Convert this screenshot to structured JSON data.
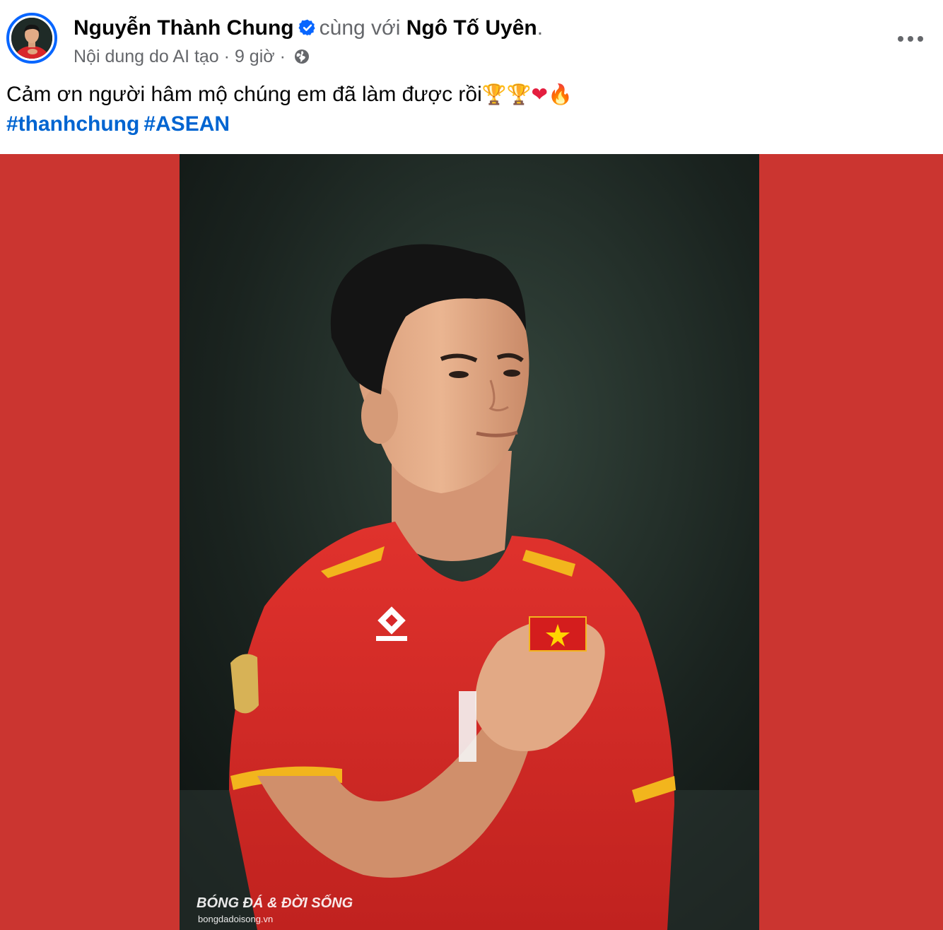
{
  "post": {
    "author_name": "Nguyễn Thành Chung",
    "with_text": "cùng với",
    "tagged_name": "Ngô Tố Uyên",
    "tagged_suffix": ".",
    "ai_label": "Nội dung do AI tạo",
    "separator": "·",
    "time": "9 giờ",
    "audience_icon": "globe-icon",
    "verified_icon": "verified-badge-icon",
    "more_icon": "more-options-icon",
    "caption_text": "Cảm ơn người hâm mộ chúng em đã làm được rồi",
    "caption_emojis": [
      "🏆",
      "🏆",
      "❤",
      "🔥"
    ],
    "hashtags": [
      "#thanhchung",
      "#ASEAN"
    ]
  },
  "media": {
    "background_color": "#cb3530",
    "watermark_logo": "BÓNG ĐÁ & ĐỜI SỐNG",
    "watermark_url": "bongdadoisong.vn"
  },
  "colors": {
    "verified": "#0866ff",
    "hashtag": "#0064d1",
    "secondary_text": "#65676b",
    "primary_text": "#050505"
  }
}
